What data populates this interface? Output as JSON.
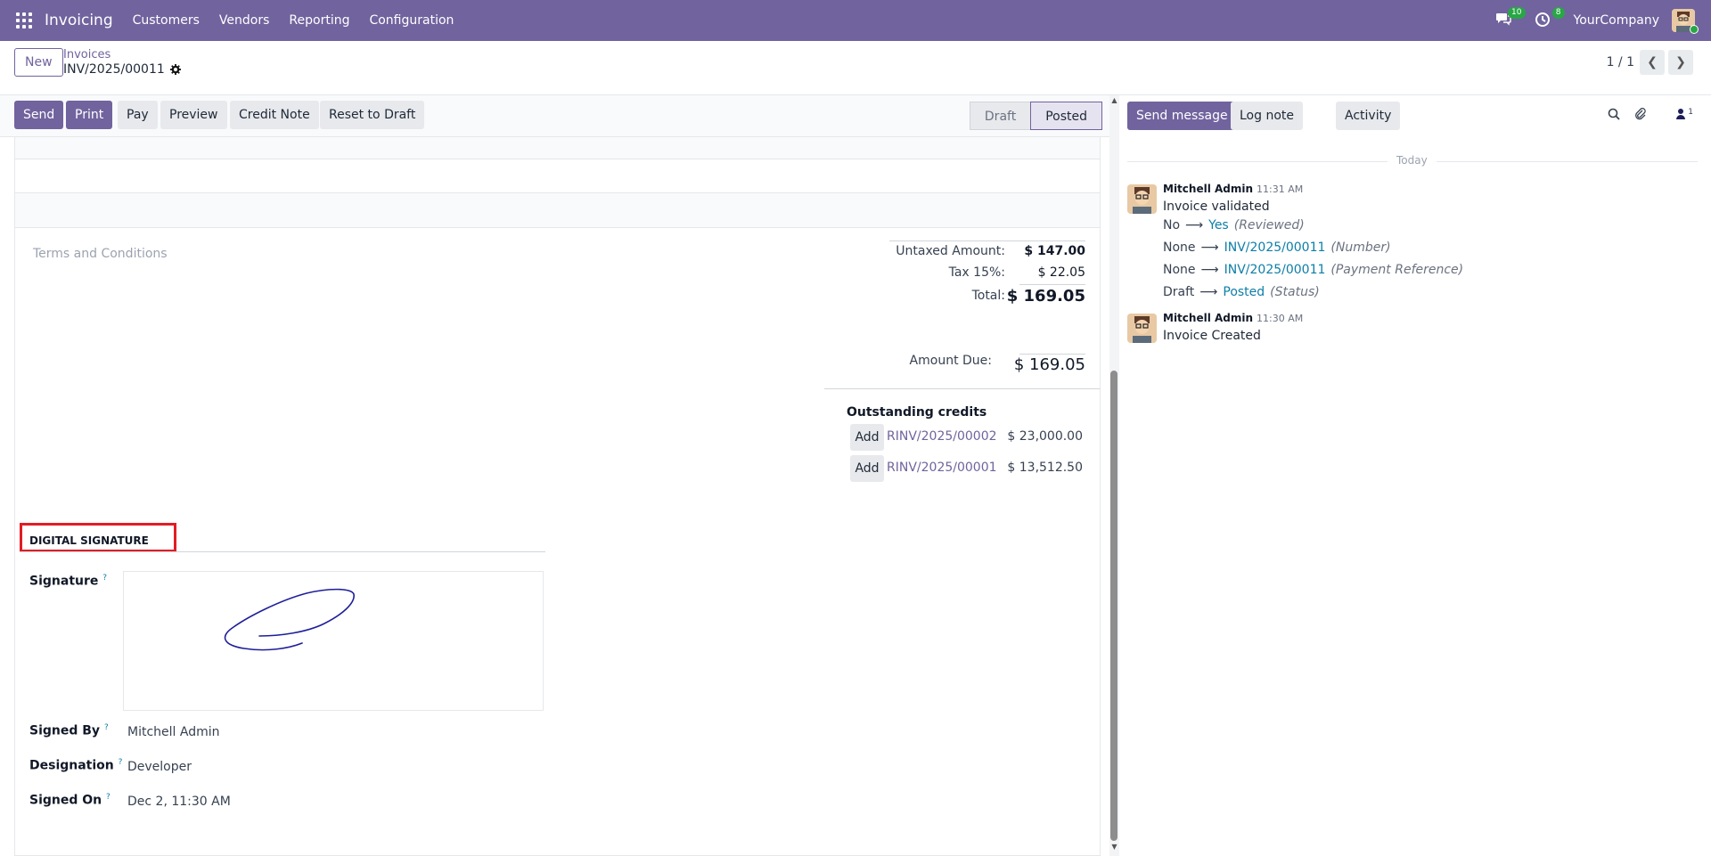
{
  "navbar": {
    "app_name": "Invoicing",
    "menu": [
      "Customers",
      "Vendors",
      "Reporting",
      "Configuration"
    ],
    "messages_count": "10",
    "activities_count": "8",
    "company": "YourCompany",
    "color": "#71639e"
  },
  "control_panel": {
    "new_label": "New",
    "breadcrumb_parent": "Invoices",
    "breadcrumb_current": "INV/2025/00011",
    "pager": "1 / 1"
  },
  "statusbar": {
    "send": "Send",
    "print": "Print",
    "pay": "Pay",
    "preview": "Preview",
    "credit_note": "Credit Note",
    "reset": "Reset to Draft",
    "stages": [
      "Draft",
      "Posted"
    ],
    "active_stage": "Posted"
  },
  "form": {
    "terms_placeholder": "Terms and Conditions",
    "untaxed_label": "Untaxed Amount:",
    "untaxed_value": "$ 147.00",
    "tax_label": "Tax 15%:",
    "tax_value": "$ 22.05",
    "total_label": "Total:",
    "total_value": "$ 169.05",
    "due_label": "Amount Due:",
    "due_value": "$ 169.05",
    "outstanding_title": "Outstanding credits",
    "credits": [
      {
        "add": "Add",
        "ref": "RINV/2025/00002",
        "amount": "$ 23,000.00"
      },
      {
        "add": "Add",
        "ref": "RINV/2025/00001",
        "amount": "$ 13,512.50"
      }
    ],
    "signature_section": "DIGITAL SIGNATURE",
    "signature_label": "Signature",
    "signed_by_label": "Signed By",
    "signed_by": "Mitchell Admin",
    "designation_label": "Designation",
    "designation": "Developer",
    "signed_on_label": "Signed On",
    "signed_on": "Dec 2, 11:30 AM",
    "help_mark": "?"
  },
  "chatter": {
    "send_message": "Send message",
    "log_note": "Log note",
    "activity": "Activity",
    "followers_count": "1",
    "date_separator": "Today",
    "messages": [
      {
        "author": "Mitchell Admin",
        "time": "11:31 AM",
        "body": "Invoice validated",
        "tracking": [
          {
            "old": "No",
            "new": "Yes",
            "field": "(Reviewed)"
          },
          {
            "old": "None",
            "new": "INV/2025/00011",
            "field": "(Number)"
          },
          {
            "old": "None",
            "new": "INV/2025/00011",
            "field": "(Payment Reference)"
          },
          {
            "old": "Draft",
            "new": "Posted",
            "field": "(Status)"
          }
        ]
      },
      {
        "author": "Mitchell Admin",
        "time": "11:30 AM",
        "body": "Invoice Created"
      }
    ]
  }
}
